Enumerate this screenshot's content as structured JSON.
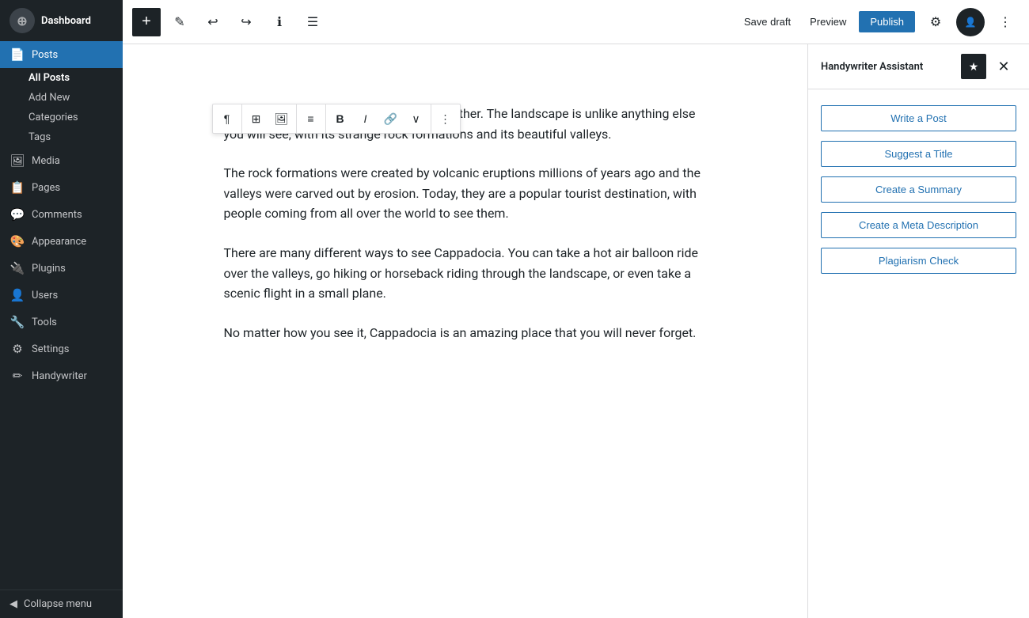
{
  "sidebar": {
    "dashboard_label": "Dashboard",
    "items": [
      {
        "id": "posts",
        "label": "Posts",
        "icon": "📄",
        "active": true
      },
      {
        "id": "media",
        "label": "Media",
        "icon": "🖼"
      },
      {
        "id": "pages",
        "label": "Pages",
        "icon": "📋"
      },
      {
        "id": "comments",
        "label": "Comments",
        "icon": "💬"
      },
      {
        "id": "appearance",
        "label": "Appearance",
        "icon": "🎨"
      },
      {
        "id": "plugins",
        "label": "Plugins",
        "icon": "🔌"
      },
      {
        "id": "users",
        "label": "Users",
        "icon": "👤"
      },
      {
        "id": "tools",
        "label": "Tools",
        "icon": "🔧"
      },
      {
        "id": "settings",
        "label": "Settings",
        "icon": "⚙"
      },
      {
        "id": "handywriter",
        "label": "Handywriter",
        "icon": "✏"
      }
    ],
    "posts_sub": [
      {
        "id": "all-posts",
        "label": "All Posts",
        "active": true
      },
      {
        "id": "add-new",
        "label": "Add New"
      },
      {
        "id": "categories",
        "label": "Categories"
      },
      {
        "id": "tags",
        "label": "Tags"
      }
    ],
    "collapse_label": "Collapse menu"
  },
  "toolbar": {
    "save_draft_label": "Save draft",
    "preview_label": "Preview",
    "publish_label": "Publish"
  },
  "editor": {
    "content": [
      "amazing and unique place that is like no other. The landscape is unlike anything else you will see, with its strange rock formations and its beautiful valleys.",
      "The rock formations were created by volcanic eruptions millions of years ago and the valleys were carved out by erosion. Today, they are a popular tourist destination, with people coming from all over the world to see them.",
      "There are many different ways to see Cappadocia. You can take a hot air balloon ride over the valleys, go hiking or horseback riding through the landscape, or even take a scenic flight in a small plane.",
      "No matter how you see it, Cappadocia is an amazing place that you will never forget."
    ]
  },
  "panel": {
    "title": "Handywriter Assistant",
    "buttons": [
      {
        "id": "write-post",
        "label": "Write a Post"
      },
      {
        "id": "suggest-title",
        "label": "Suggest a Title"
      },
      {
        "id": "create-summary",
        "label": "Create a Summary"
      },
      {
        "id": "create-meta",
        "label": "Create a Meta Description"
      },
      {
        "id": "plagiarism-check",
        "label": "Plagiarism Check"
      }
    ]
  },
  "format_toolbar": {
    "paragraph_icon": "¶",
    "bold_icon": "B",
    "italic_icon": "I",
    "align_icon": "≡",
    "link_icon": "🔗",
    "more_icon": "∨",
    "dots_icon": "⋮"
  }
}
